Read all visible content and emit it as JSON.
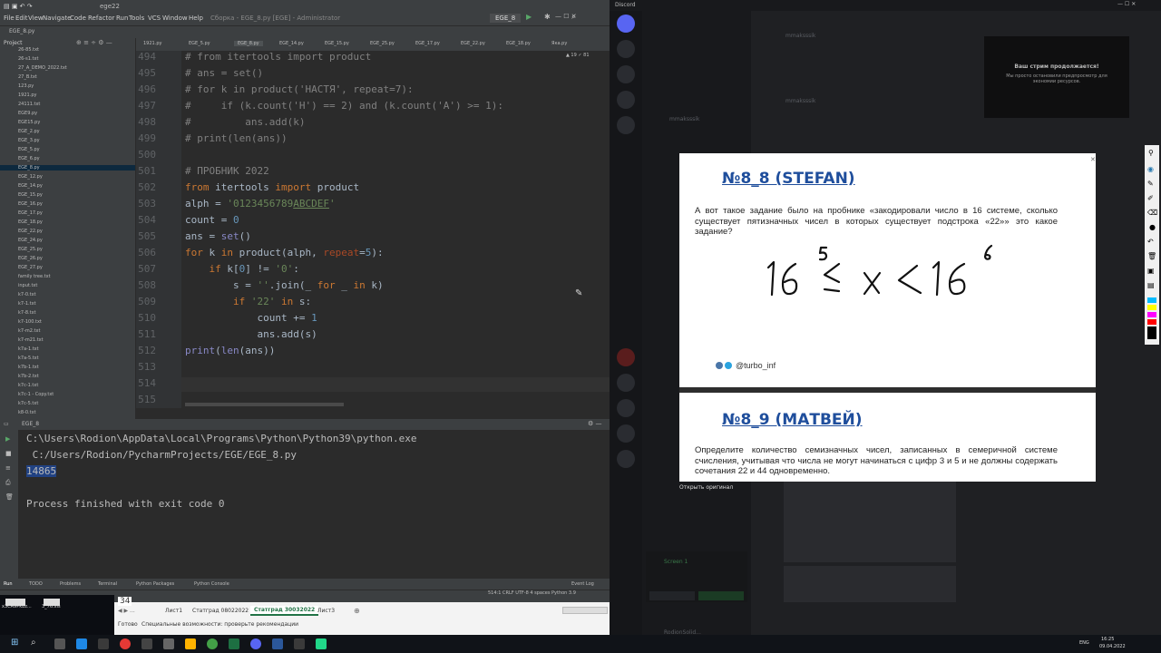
{
  "ide": {
    "title": "Сборка - EGE_8.py [EGE] - Administrator",
    "project_name": "ege22",
    "menu": [
      "File",
      "Edit",
      "View",
      "Navigate",
      "Code",
      "Refactor",
      "Run",
      "Tools",
      "VCS",
      "Window",
      "Help"
    ],
    "nav_project": "EGE_8.py",
    "run_config": "EGE_8",
    "project_label": "Project",
    "tree": [
      "26-85.txt",
      "26-s1.txt",
      "27_A_DEMO_2022.txt",
      "27_B.txt",
      "123.py",
      "1921.py",
      "24111.txt",
      "EGE9.py",
      "EGE15.py",
      "EGE_2.py",
      "EGE_3.py",
      "EGE_5.py",
      "EGE_6.py",
      "EGE_8.py",
      "EGE_12.py",
      "EGE_14.py",
      "EGE_15.py",
      "EGE_16.py",
      "EGE_17.py",
      "EGE_18.py",
      "EGE_22.py",
      "EGE_24.py",
      "EGE_25.py",
      "EGE_26.py",
      "EGE_27.py",
      "family tree.txt",
      "input.txt",
      "k7-0.txt",
      "k7-1.txt",
      "k7-8.txt",
      "k7-100.txt",
      "k7-m2.txt",
      "k7-m21.txt",
      "k7a-1.txt",
      "k7a-5.txt",
      "k7b-1.txt",
      "k7b-2.txt",
      "k7c-1.txt",
      "k7c-1 - Copy.txt",
      "k7c-5.txt",
      "k8-0.txt"
    ],
    "tabs": [
      "1921.py",
      "EGE_5.py",
      "EGE_8.py",
      "EGE_14.py",
      "EGE_15.py",
      "EGE_25.py",
      "EGE_17.py",
      "EGE_22.py",
      "EGE_18.py",
      "Яка.py"
    ],
    "inspection": "▲ 19  ✓ 81",
    "line_numbers": [
      "494",
      "495",
      "496",
      "497",
      "498",
      "499",
      "500",
      "501",
      "502",
      "503",
      "504",
      "505",
      "506",
      "507",
      "508",
      "509",
      "510",
      "511",
      "512",
      "513",
      "514",
      "515"
    ],
    "run_tab": "EGE_8",
    "output": [
      "C:\\Users\\Rodion\\AppData\\Local\\Programs\\Python\\Python39\\python.exe",
      " C:/Users/Rodion/PycharmProjects/EGE/EGE_8.py",
      "14865",
      "",
      "Process finished with exit code 0"
    ],
    "bottom_tabs": [
      "Run",
      "TODO",
      "Problems",
      "Terminal",
      "Python Packages",
      "Python Console",
      "Event Log"
    ],
    "status": "514:1  CRLF  UTF-8  4 spaces  Python 3.9"
  },
  "excel": {
    "cell_value": "34",
    "sheets": [
      "Лист1",
      "Статград 08022022",
      "Статград 30032022",
      "Лист3"
    ],
    "status": "Готово",
    "accessibility": "Специальные возможности: проверьте рекомендации",
    "file1": "x3CA9Pkbz...",
    "file2": "3_76.xls"
  },
  "discord": {
    "app_title": "Discord",
    "stream_title": "Ваш стрим продолжается!",
    "stream_sub": "Мы просто остановили предпросмотр для экономии ресурсов.",
    "user": "mmaksssik",
    "open_original": "Открыть оригинал",
    "screen_label": "Screen 1",
    "self_name": "RodionSolid..."
  },
  "slide": {
    "title1": "№8_8 (STEFAN)",
    "text1": "А вот такое задание было на пробнике «закодировали число в 16 системе, сколько существует пятизначных чисел в которых существует подстрока «22»» это какое задание?",
    "credit": "@turbo_inf",
    "title2": "№8_9 (МАТВЕЙ)",
    "text2": "Определите количество семизначных чисел, записанных в семеричной системе счисления, учитывая что числа не могут начинаться с цифр 3 и 5 и не должны содержать сочетания 22 и 44 одновременно."
  },
  "taskbar": {
    "time": "16:25",
    "date": "09.04.2022",
    "lang": "ENG"
  }
}
